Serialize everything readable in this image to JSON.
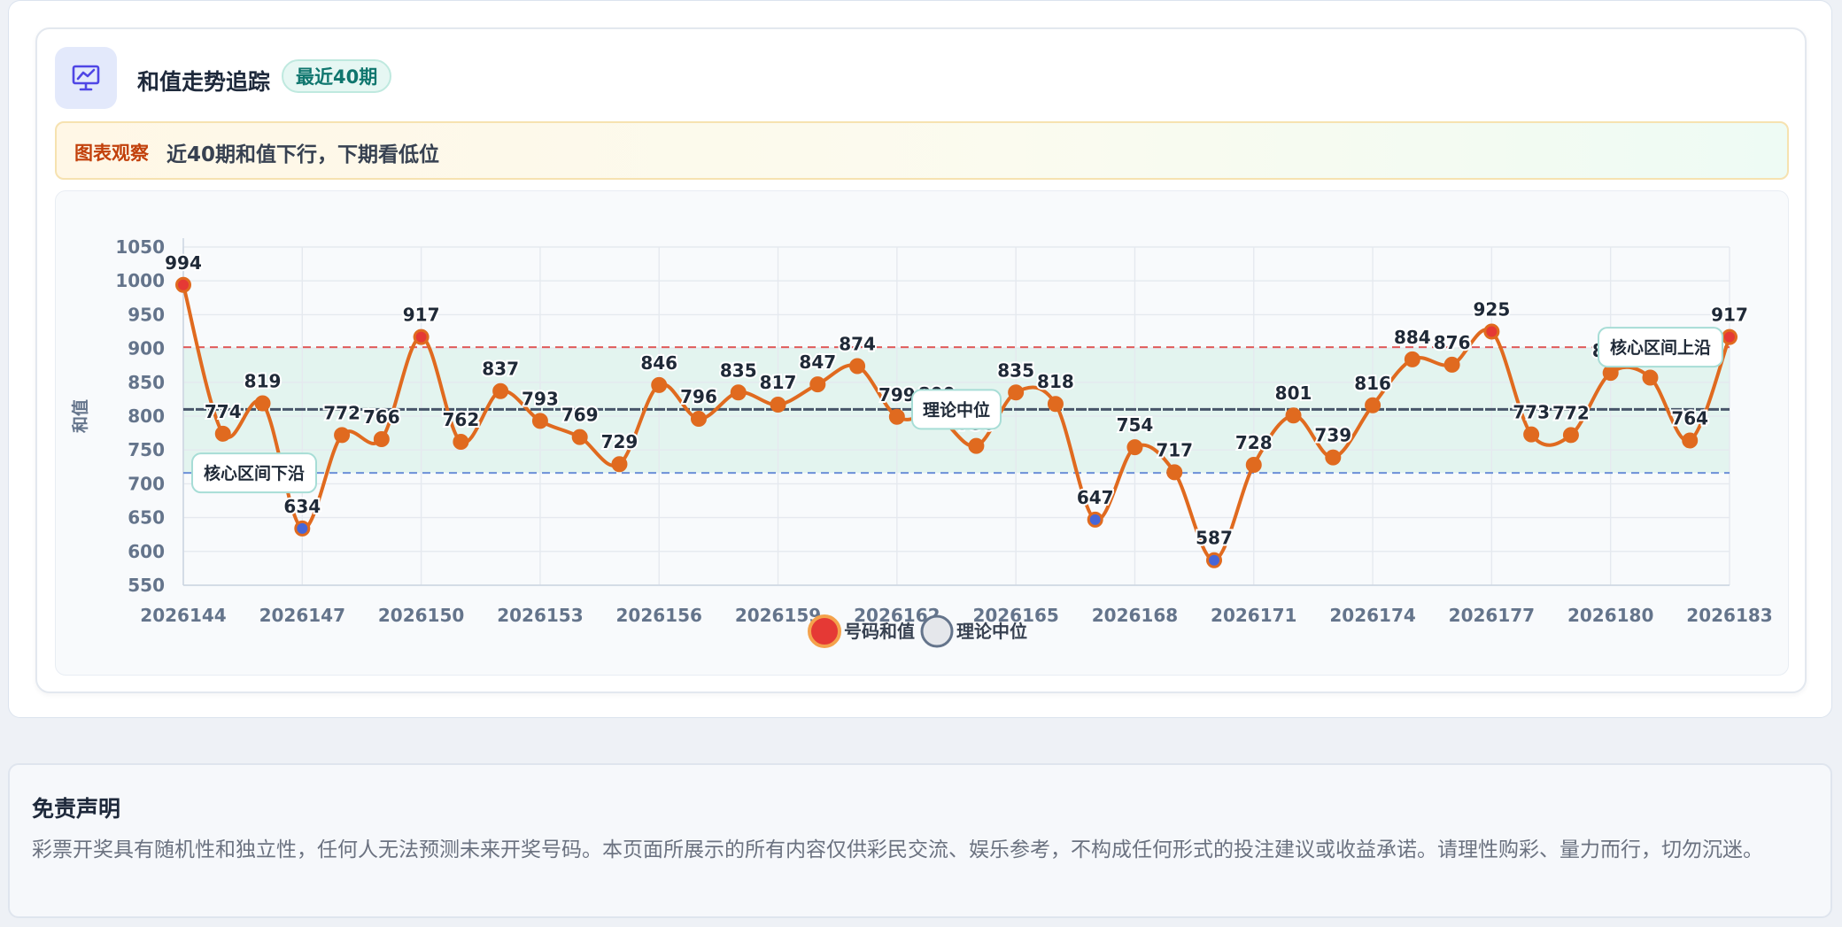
{
  "header": {
    "title": "和值走势追踪",
    "badge": "最近40期"
  },
  "observation": {
    "tag": "图表观察",
    "text": "近40期和值下行，下期看低位"
  },
  "chart_data": {
    "type": "line",
    "ylabel": "和值",
    "ylim": [
      550,
      1050
    ],
    "yticks": [
      550,
      600,
      650,
      700,
      750,
      800,
      850,
      900,
      950,
      1000,
      1050
    ],
    "x": [
      "2026144",
      "2026145",
      "2026146",
      "2026147",
      "2026148",
      "2026149",
      "2026150",
      "2026151",
      "2026152",
      "2026153",
      "2026154",
      "2026155",
      "2026156",
      "2026157",
      "2026158",
      "2026159",
      "2026160",
      "2026161",
      "2026162",
      "2026163",
      "2026164",
      "2026165",
      "2026166",
      "2026167",
      "2026168",
      "2026169",
      "2026170",
      "2026171",
      "2026172",
      "2026173",
      "2026174",
      "2026175",
      "2026176",
      "2026177",
      "2026178",
      "2026179",
      "2026180",
      "2026181",
      "2026182",
      "2026183"
    ],
    "xticks": [
      "2026144",
      "2026147",
      "2026150",
      "2026153",
      "2026156",
      "2026159",
      "2026162",
      "2026165",
      "2026168",
      "2026171",
      "2026174",
      "2026177",
      "2026180",
      "2026183"
    ],
    "series": [
      {
        "name": "号码和值",
        "color": "#e06a1f",
        "values": [
          994,
          774,
          819,
          634,
          772,
          766,
          917,
          762,
          837,
          793,
          769,
          729,
          846,
          796,
          835,
          817,
          847,
          874,
          799,
          800,
          756,
          835,
          818,
          647,
          754,
          717,
          587,
          728,
          801,
          739,
          816,
          884,
          876,
          925,
          773,
          772,
          864,
          857,
          764,
          917
        ]
      },
      {
        "name": "理论中位",
        "color": "#475569",
        "value": 810
      }
    ],
    "reference_lines": [
      {
        "label": "核心区间上沿",
        "value": 902,
        "color": "#e05a5a"
      },
      {
        "label": "核心区间下沿",
        "value": 716,
        "color": "#6c8fd8"
      }
    ],
    "band": {
      "from": 716,
      "to": 902,
      "color": "#e3f4ef"
    },
    "median_label": "理论中位",
    "highlights": {
      "high": [
        0,
        6,
        33,
        39
      ],
      "low": [
        3,
        23,
        26
      ]
    },
    "legend": {
      "placement": "bottom-center",
      "items": [
        "号码和值",
        "理论中位"
      ]
    },
    "grid": true
  },
  "disclaimer": {
    "title": "免责声明",
    "text": "彩票开奖具有随机性和独立性，任何人无法预测未来开奖号码。本页面所展示的所有内容仅供彩民交流、娱乐参考，不构成任何形式的投注建议或收益承诺。请理性购彩、量力而行，切勿沉迷。"
  }
}
